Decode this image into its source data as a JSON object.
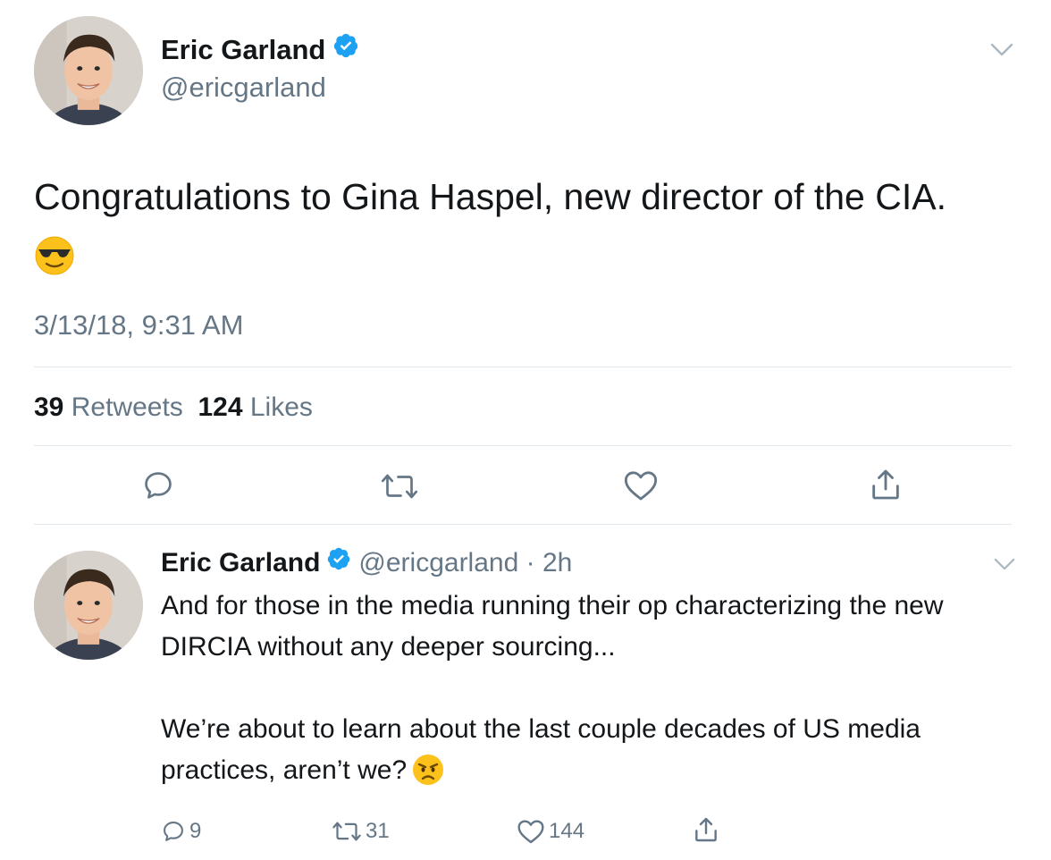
{
  "main_tweet": {
    "author_name": "Eric Garland",
    "handle": "@ericgarland",
    "text": "Congratulations to Gina Haspel, new director of the CIA.",
    "emoji": "smiling-face-with-sunglasses",
    "timestamp": "3/13/18, 9:31 AM",
    "retweet_count": "39",
    "retweet_label": "Retweets",
    "like_count": "124",
    "like_label": "Likes",
    "actions": [
      "reply",
      "retweet",
      "like",
      "share"
    ]
  },
  "reply_tweet": {
    "author_name": "Eric Garland",
    "handle_time": "@ericgarland · 2h",
    "paragraph1": "And for those in the media running their op characterizing the new DIRCIA without any deeper sourcing...",
    "paragraph2": "We’re about to learn about the last couple decades of US media practices, aren’t we?",
    "emoji": "angry-face",
    "reply_count": "9",
    "retweet_count": "31",
    "like_count": "144"
  },
  "colors": {
    "text": "#14171a",
    "secondary": "#657786",
    "divider": "#e1e8ed",
    "verified": "#1da1f2"
  }
}
